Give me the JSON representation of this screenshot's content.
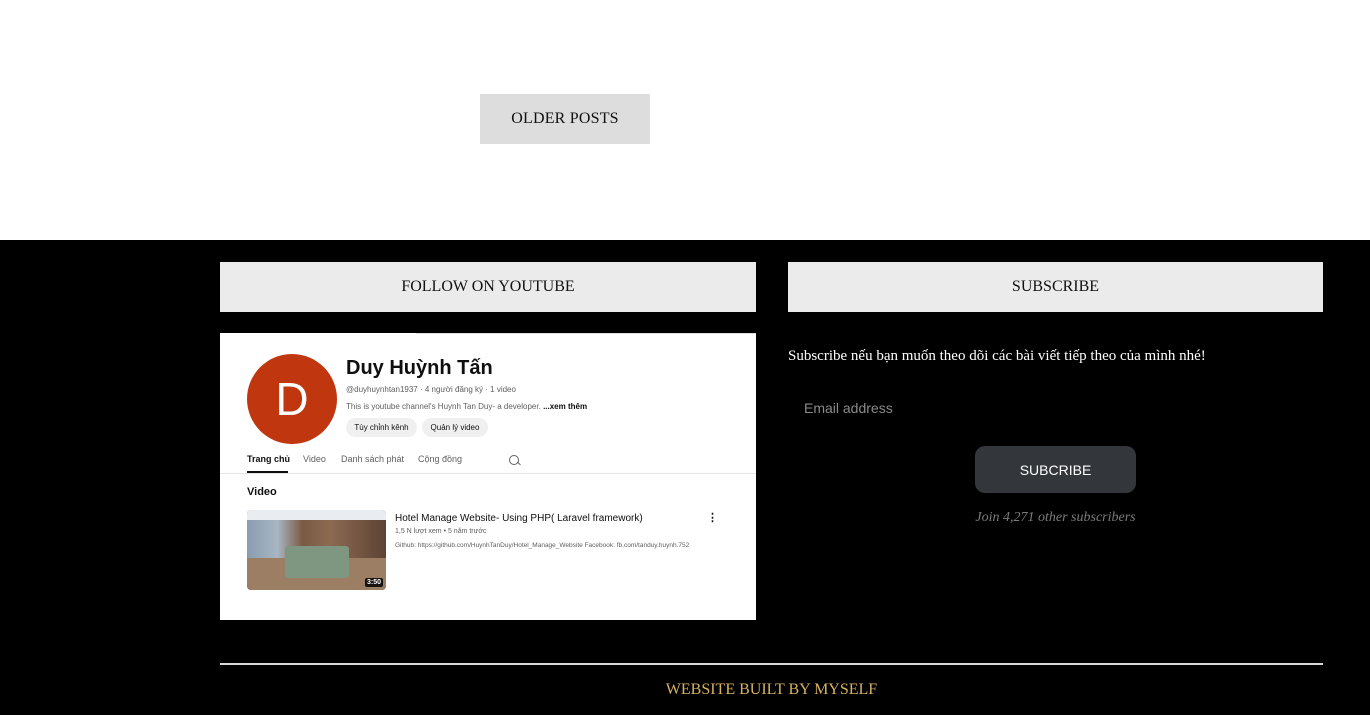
{
  "pagination": {
    "older_posts_label": "OLDER POSTS"
  },
  "youtube_widget": {
    "heading": "FOLLOW ON YOUTUBE",
    "avatar_letter": "D",
    "channel_name": "Duy Huỳnh Tấn",
    "channel_meta": "@duyhuynhtan1937 · 4 người đăng ký · 1 video",
    "channel_desc": "This is youtube channel's Huynh Tan Duy- a developer.",
    "see_more": "...xem thêm",
    "chip_customize": "Tùy chỉnh kênh",
    "chip_manage": "Quản lý video",
    "tabs": [
      "Trang chủ",
      "Video",
      "Danh sách phát",
      "Cộng đồng"
    ],
    "section_title": "Video",
    "video": {
      "title": "Hotel Manage Website- Using PHP( Laravel framework)",
      "meta": "1,5 N lượt xem • 5 năm trước",
      "desc": "Github: https://github.com/HuynhTanDuy/Hotel_Manage_Website Facebook: fb.com/tanduy.huynh.752",
      "duration": "3:50"
    },
    "colors": {
      "avatar": "#c0360f"
    }
  },
  "subscribe_widget": {
    "heading": "SUBSCRIBE",
    "text": "Subscribe nếu bạn muốn theo dõi các bài viết tiếp theo của mình nhé!",
    "email_placeholder": "Email address",
    "button_label": "SUBCRIBE",
    "subscriber_count": "Join 4,271 other subscribers"
  },
  "footer": {
    "credit": "WEBSITE BUILT BY MYSELF",
    "colors": {
      "credit": "#d9b262",
      "background": "#000000"
    }
  }
}
